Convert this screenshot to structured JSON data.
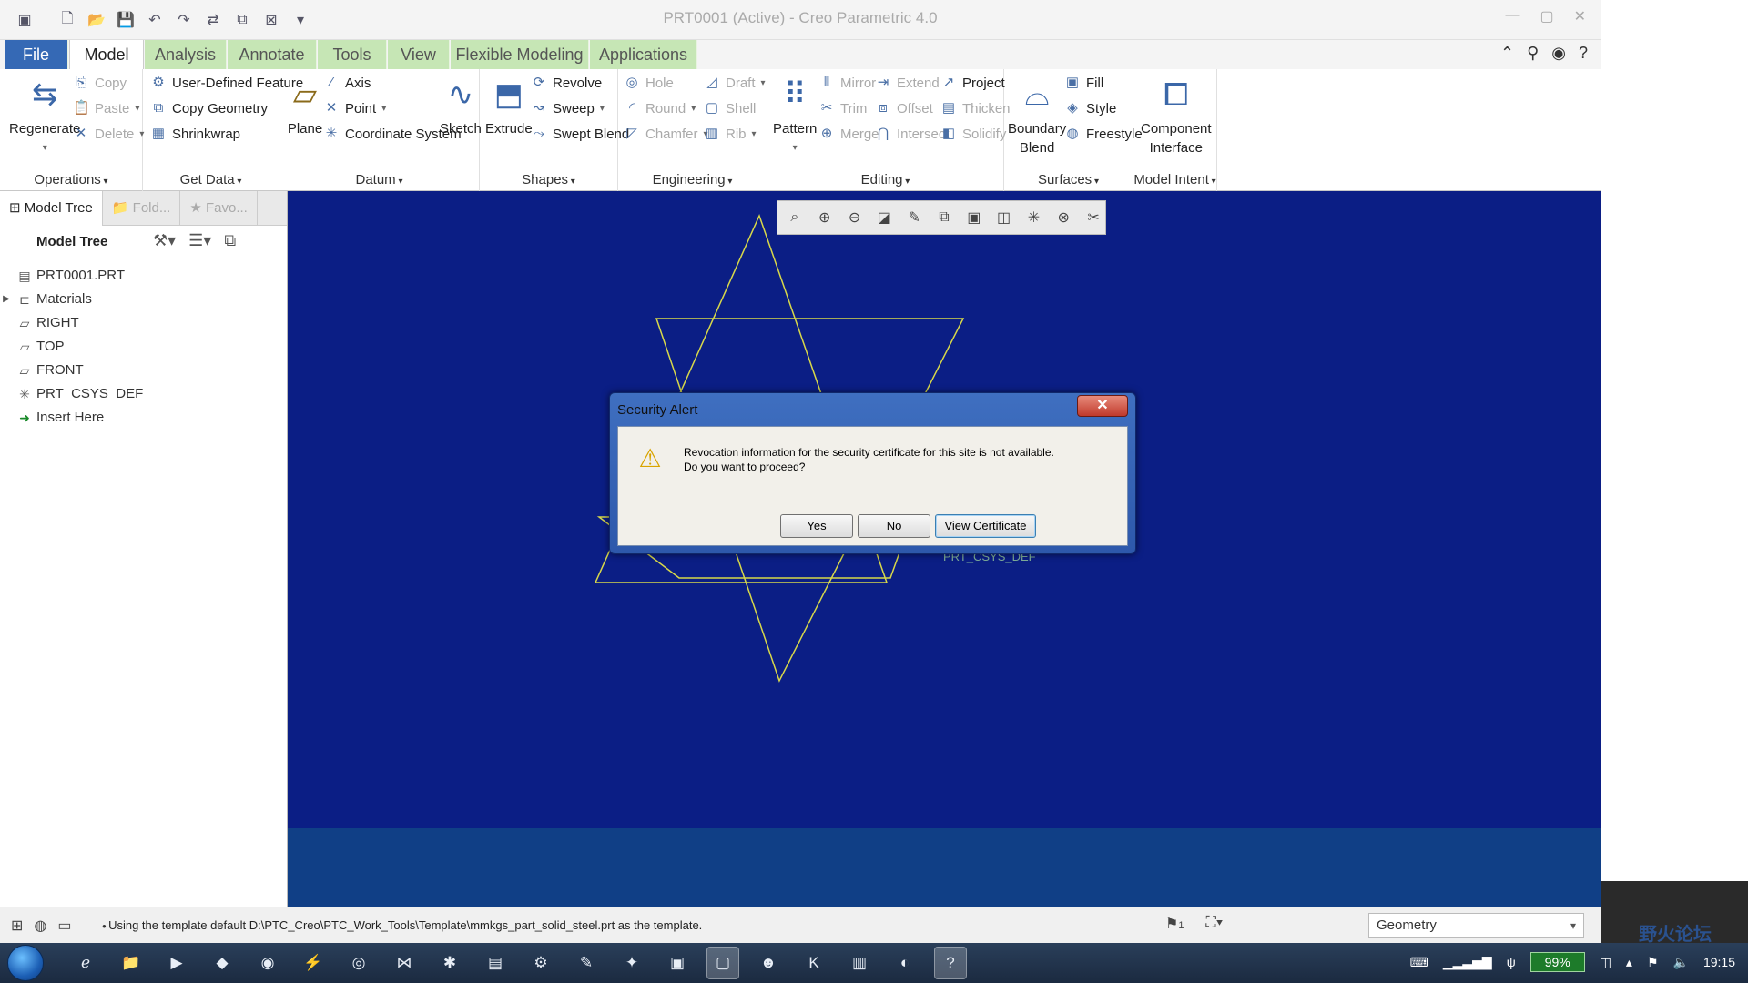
{
  "window": {
    "title": "PRT0001 (Active) - Creo Parametric 4.0"
  },
  "tabs": [
    {
      "label": "File"
    },
    {
      "label": "Model"
    },
    {
      "label": "Analysis"
    },
    {
      "label": "Annotate"
    },
    {
      "label": "Tools"
    },
    {
      "label": "View"
    },
    {
      "label": "Flexible Modeling"
    },
    {
      "label": "Applications"
    }
  ],
  "ribbon": {
    "operations": {
      "label": "Operations",
      "regenerate": "Regenerate",
      "copy": "Copy",
      "paste": "Paste",
      "delete": "Delete"
    },
    "getdata": {
      "label": "Get Data",
      "udf": "User-Defined Feature",
      "copygeom": "Copy Geometry",
      "shrinkwrap": "Shrinkwrap"
    },
    "datum": {
      "label": "Datum",
      "plane": "Plane",
      "axis": "Axis",
      "point": "Point",
      "csys": "Coordinate System",
      "sketch": "Sketch"
    },
    "shapes": {
      "label": "Shapes",
      "extrude": "Extrude",
      "revolve": "Revolve",
      "sweep": "Sweep",
      "sweptblend": "Swept Blend"
    },
    "engineering": {
      "label": "Engineering",
      "hole": "Hole",
      "round": "Round",
      "chamfer": "Chamfer",
      "draft": "Draft",
      "shell": "Shell",
      "rib": "Rib"
    },
    "editing": {
      "label": "Editing",
      "pattern": "Pattern",
      "mirror": "Mirror",
      "trim": "Trim",
      "merge": "Merge",
      "extend": "Extend",
      "offset": "Offset",
      "intersect": "Intersect",
      "project": "Project",
      "thicken": "Thicken",
      "solidify": "Solidify"
    },
    "surfaces": {
      "label": "Surfaces",
      "boundary1": "Boundary",
      "boundary2": "Blend",
      "fill": "Fill",
      "style": "Style",
      "freestyle": "Freestyle"
    },
    "modelintent": {
      "label": "Model Intent",
      "ci1": "Component",
      "ci2": "Interface"
    }
  },
  "panel": {
    "tabs": [
      {
        "label": "Model Tree"
      },
      {
        "label": "Fold..."
      },
      {
        "label": "Favo..."
      }
    ],
    "header": "Model Tree",
    "tree": [
      {
        "label": "PRT0001.PRT"
      },
      {
        "label": "Materials"
      },
      {
        "label": "RIGHT"
      },
      {
        "label": "TOP"
      },
      {
        "label": "FRONT"
      },
      {
        "label": "PRT_CSYS_DEF"
      },
      {
        "label": "Insert Here"
      }
    ]
  },
  "graphics": {
    "csys_label": "PRT_CSYS_DEF"
  },
  "dialog": {
    "title": "Security Alert",
    "message_line1": "Revocation information for the security certificate for this site is not available.",
    "message_line2": "Do you want to proceed?",
    "yes": "Yes",
    "no": "No",
    "view_certificate": "View Certificate"
  },
  "status": {
    "message": "Using the template default D:\\PTC_Creo\\PTC_Work_Tools\\Template\\mmkgs_part_solid_steel.prt as the template.",
    "flag_count": "1",
    "filter": "Geometry"
  },
  "taskbar": {
    "battery": "99%",
    "time": "19:15"
  },
  "watermark": "野火论坛",
  "colors": {
    "graphics_bg": "#0b1e85",
    "datum_lines": "#d8d84a",
    "tab_green": "#c6e6b5",
    "file_tab": "#3569b5"
  }
}
